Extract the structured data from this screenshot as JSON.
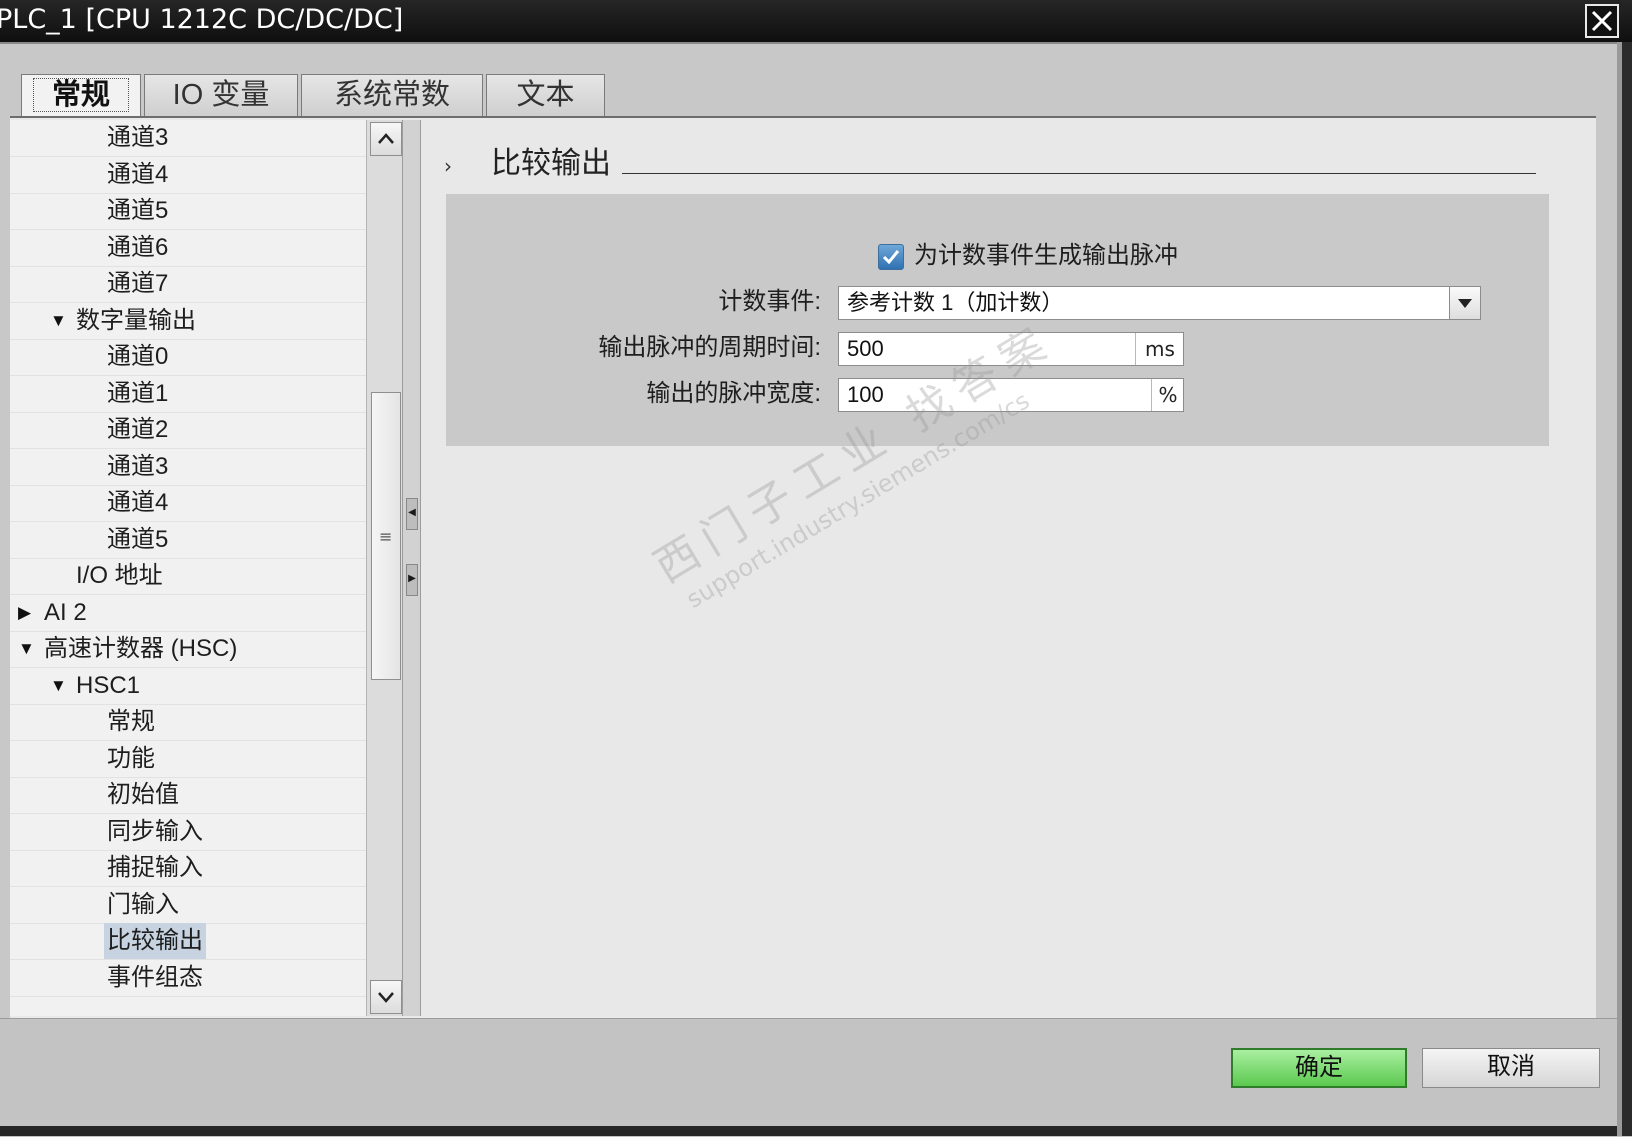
{
  "window": {
    "title": "PLC_1 [CPU 1212C DC/DC/DC]",
    "close_glyph": "X"
  },
  "tabs": [
    {
      "label": "常规",
      "active": true
    },
    {
      "label": "IO 变量",
      "active": false
    },
    {
      "label": "系统常数",
      "active": false
    },
    {
      "label": "文本",
      "active": false
    }
  ],
  "tree": {
    "items": [
      {
        "label": "通道3",
        "level": 3,
        "toggle": "none"
      },
      {
        "label": "通道4",
        "level": 3,
        "toggle": "none"
      },
      {
        "label": "通道5",
        "level": 3,
        "toggle": "none"
      },
      {
        "label": "通道6",
        "level": 3,
        "toggle": "none"
      },
      {
        "label": "通道7",
        "level": 3,
        "toggle": "none"
      },
      {
        "label": "数字量输出",
        "level": 2,
        "toggle": "expanded"
      },
      {
        "label": "通道0",
        "level": 3,
        "toggle": "none"
      },
      {
        "label": "通道1",
        "level": 3,
        "toggle": "none"
      },
      {
        "label": "通道2",
        "level": 3,
        "toggle": "none"
      },
      {
        "label": "通道3",
        "level": 3,
        "toggle": "none"
      },
      {
        "label": "通道4",
        "level": 3,
        "toggle": "none"
      },
      {
        "label": "通道5",
        "level": 3,
        "toggle": "none"
      },
      {
        "label": "I/O 地址",
        "level": 2,
        "toggle": "none"
      },
      {
        "label": "AI 2",
        "level": 1,
        "toggle": "collapsed"
      },
      {
        "label": "高速计数器 (HSC)",
        "level": 1,
        "toggle": "expanded"
      },
      {
        "label": "HSC1",
        "level": 2,
        "toggle": "expanded"
      },
      {
        "label": "常规",
        "level": 3,
        "toggle": "none"
      },
      {
        "label": "功能",
        "level": 3,
        "toggle": "none"
      },
      {
        "label": "初始值",
        "level": 3,
        "toggle": "none"
      },
      {
        "label": "同步输入",
        "level": 3,
        "toggle": "none"
      },
      {
        "label": "捕捉输入",
        "level": 3,
        "toggle": "none"
      },
      {
        "label": "门输入",
        "level": 3,
        "toggle": "none"
      },
      {
        "label": "比较输出",
        "level": 3,
        "toggle": "none",
        "selected": true
      },
      {
        "label": "事件组态",
        "level": 3,
        "toggle": "none"
      }
    ]
  },
  "section": {
    "title": "比较输出",
    "checkbox": {
      "label": "为计数事件生成输出脉冲",
      "checked": true
    },
    "fields": {
      "count_event": {
        "label": "计数事件:",
        "value": "参考计数 1（加计数）"
      },
      "period": {
        "label": "输出脉冲的周期时间:",
        "value": "500",
        "unit": "ms"
      },
      "width": {
        "label": "输出的脉冲宽度:",
        "value": "100",
        "unit": "%"
      }
    }
  },
  "watermark": {
    "line1": "西门子工业  找答案",
    "line2": "support.industry.siemens.com/cs"
  },
  "buttons": {
    "ok": "确定",
    "cancel": "取消"
  },
  "colors": {
    "ok_button": "#5bc94f",
    "selection": "#c7d3e0",
    "titlebar": "#1a1a1a"
  }
}
